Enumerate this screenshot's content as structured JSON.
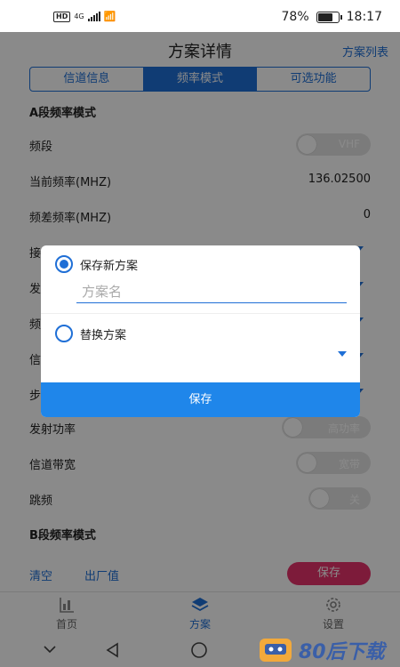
{
  "status_bar": {
    "network": "HD",
    "signal": "4G",
    "battery": "78%",
    "battery_level": 0.78,
    "time": "18:17"
  },
  "header": {
    "title": "方案详情",
    "plan_list": "方案列表"
  },
  "tabs": [
    {
      "label": "信道信息",
      "active": false
    },
    {
      "label": "频率模式",
      "active": true
    },
    {
      "label": "可选功能",
      "active": false
    }
  ],
  "section_a": {
    "title": "A段频率模式",
    "band": {
      "label": "频段",
      "value": "VHF"
    },
    "current_freq": {
      "label": "当前频率(MHZ)",
      "value": "136.02500"
    },
    "diff_freq": {
      "label": "频差频率(MHZ)",
      "value": "0"
    },
    "partial_labels": [
      "接",
      "发",
      "频",
      "信",
      "步"
    ],
    "tx_power": {
      "label": "发射功率",
      "value": "高功率"
    },
    "bandwidth": {
      "label": "信道带宽",
      "value": "宽带"
    },
    "hopping": {
      "label": "跳频",
      "value": "关"
    }
  },
  "section_b": {
    "title": "B段频率模式"
  },
  "footer": {
    "clear": "清空",
    "factory": "出厂值",
    "save": "保存"
  },
  "bottom_nav": [
    {
      "label": "首页",
      "icon": "home-icon",
      "active": false
    },
    {
      "label": "方案",
      "icon": "layers-icon",
      "active": true
    },
    {
      "label": "设置",
      "icon": "gear-icon",
      "active": false
    }
  ],
  "dialog": {
    "option_new": "保存新方案",
    "name_placeholder": "方案名",
    "option_replace": "替换方案",
    "save": "保存"
  },
  "colors": {
    "accent": "#1f6fd6",
    "dialog_button": "#1f86ea",
    "save_red": "#e8336b"
  },
  "watermark": {
    "text": "80后下载"
  }
}
